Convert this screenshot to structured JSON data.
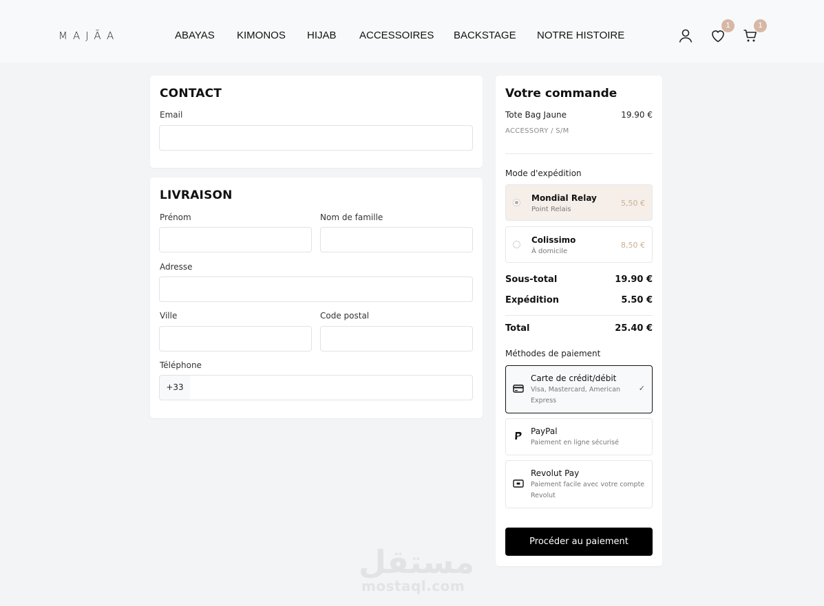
{
  "brand": {
    "logo": "MAJĀA"
  },
  "nav": {
    "items": [
      "ABAYAS",
      "KIMONOS",
      "HIJAB",
      "ACCESSOIRES",
      "BACKSTAGE",
      "NOTRE HISTOIRE"
    ]
  },
  "header_icons": {
    "account": "user-icon",
    "wishlist": "heart-icon",
    "cart": "cart-icon",
    "wishlist_count": "1",
    "cart_count": "1"
  },
  "contact": {
    "title": "CONTACT",
    "email_label": "Email",
    "email_value": ""
  },
  "delivery": {
    "title": "LIVRAISON",
    "first_name_label": "Prénom",
    "last_name_label": "Nom de famille",
    "address_label": "Adresse",
    "city_label": "Ville",
    "postal_label": "Code postal",
    "phone_label": "Téléphone",
    "phone_prefix": "+33"
  },
  "order": {
    "title": "Votre commande",
    "item_name": "Tote Bag Jaune",
    "item_price": "19.90 €",
    "item_variant": "ACCESSORY / S/M",
    "shipping_title": "Mode d'expédition",
    "shipping_options": [
      {
        "name": "Mondial Relay",
        "sub": "Point Relais",
        "price": "5,50 €",
        "selected": true
      },
      {
        "name": "Colissimo",
        "sub": "À domicile",
        "price": "8,50 €",
        "selected": false
      }
    ],
    "subtotal_label": "Sous-total",
    "subtotal_value": "19.90 €",
    "shipping_label": "Expédition",
    "shipping_value": "5.50 €",
    "total_label": "Total",
    "total_value": "25.40 €",
    "payment_title": "Méthodes de paiement",
    "payment_options": [
      {
        "name": "Carte de crédit/débit",
        "desc": "Visa, Mastercard, American Express",
        "icon": "credit-card-icon",
        "selected": true
      },
      {
        "name": "PayPal",
        "desc": "Paiement en ligne sécurisé",
        "icon": "paypal-icon",
        "selected": false
      },
      {
        "name": "Revolut Pay",
        "desc": "Paiement facile avec votre compte Revolut",
        "icon": "revolut-icon",
        "selected": false
      }
    ],
    "cta_label": "Procéder au paiement"
  },
  "watermark": {
    "arabic": "مستقل",
    "latin": "mostaql.com"
  },
  "colors": {
    "accent": "#d6b8a4",
    "selected_shipping_bg": "#f6efe9",
    "price_muted": "#c9ad93",
    "cta_bg": "#000000"
  }
}
